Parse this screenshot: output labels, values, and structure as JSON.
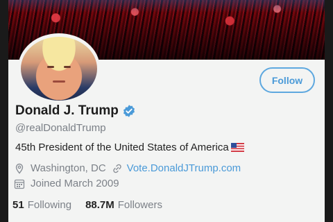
{
  "profile": {
    "name": "Donald J. Trump",
    "handle": "@realDonaldTrump",
    "bio": "45th President of the United States of America",
    "location": "Washington, DC",
    "website": "Vote.DonaldJTrump.com",
    "joined": "Joined March 2009",
    "following_count": "51",
    "following_label": "Following",
    "followers_count": "88.7M",
    "followers_label": "Followers"
  },
  "actions": {
    "follow_label": "Follow"
  },
  "colors": {
    "accent": "#4a9ad8",
    "verified": "#4a9ad8",
    "muted_text": "#7c8188"
  },
  "icons": [
    "verified-badge-icon",
    "us-flag-icon",
    "location-pin-icon",
    "link-icon",
    "calendar-icon"
  ]
}
